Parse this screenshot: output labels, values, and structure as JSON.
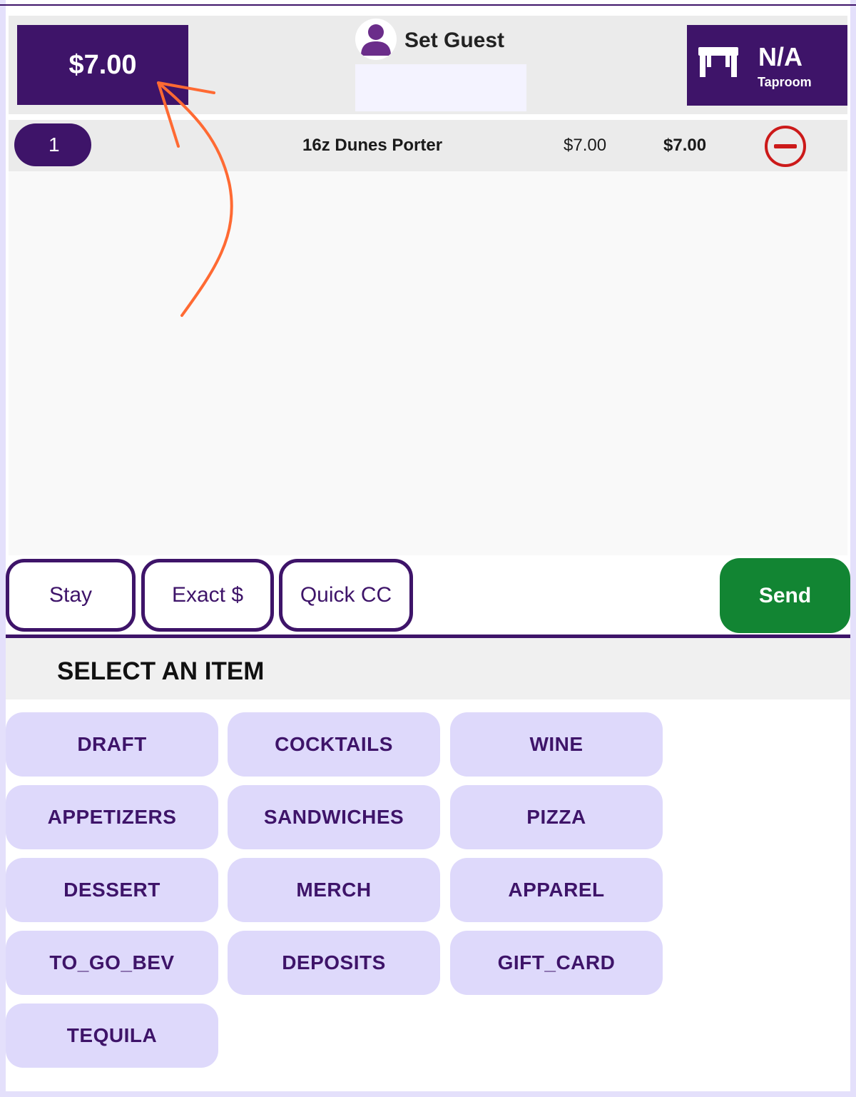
{
  "header": {
    "total": "$7.00",
    "guest_label": "Set Guest",
    "guest_input_value": "",
    "table": {
      "number": "N/A",
      "area": "Taproom"
    }
  },
  "order": {
    "items": [
      {
        "qty": "1",
        "name": "16z Dunes Porter",
        "price": "$7.00",
        "total": "$7.00"
      }
    ]
  },
  "actions": {
    "stay": "Stay",
    "exact": "Exact $",
    "quick_cc": "Quick CC",
    "send": "Send"
  },
  "menu": {
    "title": "SELECT AN ITEM",
    "categories": [
      "DRAFT",
      "COCKTAILS",
      "WINE",
      "APPETIZERS",
      "SANDWICHES",
      "PIZZA",
      "DESSERT",
      "MERCH",
      "APPAREL",
      "TO_GO_BEV",
      "DEPOSITS",
      "GIFT_CARD",
      "TEQUILA"
    ]
  },
  "colors": {
    "brand": "#3e1469",
    "send": "#128533",
    "category_bg": "#ded9fb",
    "remove": "#cc1a1a",
    "annotation": "#ff6a33"
  },
  "icons": {
    "guest": "person-icon",
    "table": "table-icon",
    "remove": "minus-circle-icon"
  }
}
